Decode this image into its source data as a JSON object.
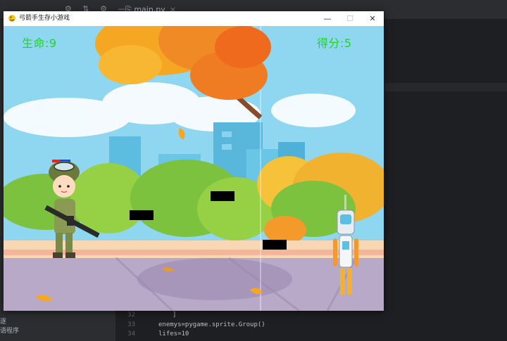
{
  "ide": {
    "tab_label": "main.py",
    "left_bottom_text": "语程序",
    "left_bottom_text2": "逐",
    "code_lines": [
      {
        "no": "32",
        "text": "]"
      },
      {
        "no": "33",
        "text": "enemys=pygame.sprite.Group()"
      },
      {
        "no": "34",
        "text": "lifes=10"
      }
    ]
  },
  "window": {
    "title": "弓箭手生存小游戏",
    "minimize_glyph": "—",
    "maximize_glyph": "☐",
    "close_glyph": "✕"
  },
  "hud": {
    "lives_text": "生命:9",
    "score_text": "得分:5",
    "text_color": "#23d12e"
  },
  "icons": [
    "gear-icon",
    "file-icon",
    "minimize-icon",
    "maximize-icon",
    "close-icon"
  ]
}
